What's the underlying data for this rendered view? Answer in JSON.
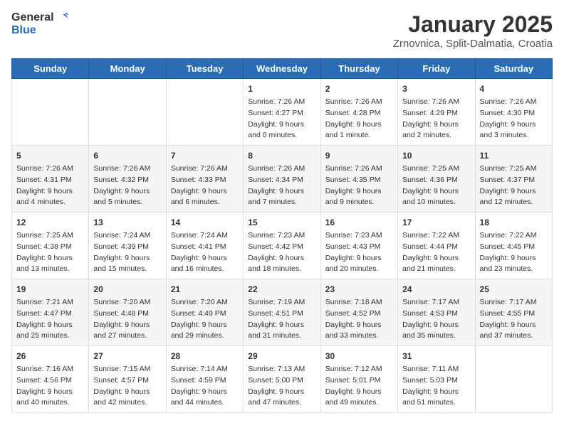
{
  "header": {
    "logo_general": "General",
    "logo_blue": "Blue",
    "title": "January 2025",
    "location": "Zrnovnica, Split-Dalmatia, Croatia"
  },
  "weekdays": [
    "Sunday",
    "Monday",
    "Tuesday",
    "Wednesday",
    "Thursday",
    "Friday",
    "Saturday"
  ],
  "weeks": [
    [
      {
        "day": "",
        "sunrise": "",
        "sunset": "",
        "daylight": "",
        "empty": true
      },
      {
        "day": "",
        "sunrise": "",
        "sunset": "",
        "daylight": "",
        "empty": true
      },
      {
        "day": "",
        "sunrise": "",
        "sunset": "",
        "daylight": "",
        "empty": true
      },
      {
        "day": "1",
        "sunrise": "Sunrise: 7:26 AM",
        "sunset": "Sunset: 4:27 PM",
        "daylight": "Daylight: 9 hours and 0 minutes."
      },
      {
        "day": "2",
        "sunrise": "Sunrise: 7:26 AM",
        "sunset": "Sunset: 4:28 PM",
        "daylight": "Daylight: 9 hours and 1 minute."
      },
      {
        "day": "3",
        "sunrise": "Sunrise: 7:26 AM",
        "sunset": "Sunset: 4:29 PM",
        "daylight": "Daylight: 9 hours and 2 minutes."
      },
      {
        "day": "4",
        "sunrise": "Sunrise: 7:26 AM",
        "sunset": "Sunset: 4:30 PM",
        "daylight": "Daylight: 9 hours and 3 minutes."
      }
    ],
    [
      {
        "day": "5",
        "sunrise": "Sunrise: 7:26 AM",
        "sunset": "Sunset: 4:31 PM",
        "daylight": "Daylight: 9 hours and 4 minutes."
      },
      {
        "day": "6",
        "sunrise": "Sunrise: 7:26 AM",
        "sunset": "Sunset: 4:32 PM",
        "daylight": "Daylight: 9 hours and 5 minutes."
      },
      {
        "day": "7",
        "sunrise": "Sunrise: 7:26 AM",
        "sunset": "Sunset: 4:33 PM",
        "daylight": "Daylight: 9 hours and 6 minutes."
      },
      {
        "day": "8",
        "sunrise": "Sunrise: 7:26 AM",
        "sunset": "Sunset: 4:34 PM",
        "daylight": "Daylight: 9 hours and 7 minutes."
      },
      {
        "day": "9",
        "sunrise": "Sunrise: 7:26 AM",
        "sunset": "Sunset: 4:35 PM",
        "daylight": "Daylight: 9 hours and 9 minutes."
      },
      {
        "day": "10",
        "sunrise": "Sunrise: 7:25 AM",
        "sunset": "Sunset: 4:36 PM",
        "daylight": "Daylight: 9 hours and 10 minutes."
      },
      {
        "day": "11",
        "sunrise": "Sunrise: 7:25 AM",
        "sunset": "Sunset: 4:37 PM",
        "daylight": "Daylight: 9 hours and 12 minutes."
      }
    ],
    [
      {
        "day": "12",
        "sunrise": "Sunrise: 7:25 AM",
        "sunset": "Sunset: 4:38 PM",
        "daylight": "Daylight: 9 hours and 13 minutes."
      },
      {
        "day": "13",
        "sunrise": "Sunrise: 7:24 AM",
        "sunset": "Sunset: 4:39 PM",
        "daylight": "Daylight: 9 hours and 15 minutes."
      },
      {
        "day": "14",
        "sunrise": "Sunrise: 7:24 AM",
        "sunset": "Sunset: 4:41 PM",
        "daylight": "Daylight: 9 hours and 16 minutes."
      },
      {
        "day": "15",
        "sunrise": "Sunrise: 7:23 AM",
        "sunset": "Sunset: 4:42 PM",
        "daylight": "Daylight: 9 hours and 18 minutes."
      },
      {
        "day": "16",
        "sunrise": "Sunrise: 7:23 AM",
        "sunset": "Sunset: 4:43 PM",
        "daylight": "Daylight: 9 hours and 20 minutes."
      },
      {
        "day": "17",
        "sunrise": "Sunrise: 7:22 AM",
        "sunset": "Sunset: 4:44 PM",
        "daylight": "Daylight: 9 hours and 21 minutes."
      },
      {
        "day": "18",
        "sunrise": "Sunrise: 7:22 AM",
        "sunset": "Sunset: 4:45 PM",
        "daylight": "Daylight: 9 hours and 23 minutes."
      }
    ],
    [
      {
        "day": "19",
        "sunrise": "Sunrise: 7:21 AM",
        "sunset": "Sunset: 4:47 PM",
        "daylight": "Daylight: 9 hours and 25 minutes."
      },
      {
        "day": "20",
        "sunrise": "Sunrise: 7:20 AM",
        "sunset": "Sunset: 4:48 PM",
        "daylight": "Daylight: 9 hours and 27 minutes."
      },
      {
        "day": "21",
        "sunrise": "Sunrise: 7:20 AM",
        "sunset": "Sunset: 4:49 PM",
        "daylight": "Daylight: 9 hours and 29 minutes."
      },
      {
        "day": "22",
        "sunrise": "Sunrise: 7:19 AM",
        "sunset": "Sunset: 4:51 PM",
        "daylight": "Daylight: 9 hours and 31 minutes."
      },
      {
        "day": "23",
        "sunrise": "Sunrise: 7:18 AM",
        "sunset": "Sunset: 4:52 PM",
        "daylight": "Daylight: 9 hours and 33 minutes."
      },
      {
        "day": "24",
        "sunrise": "Sunrise: 7:17 AM",
        "sunset": "Sunset: 4:53 PM",
        "daylight": "Daylight: 9 hours and 35 minutes."
      },
      {
        "day": "25",
        "sunrise": "Sunrise: 7:17 AM",
        "sunset": "Sunset: 4:55 PM",
        "daylight": "Daylight: 9 hours and 37 minutes."
      }
    ],
    [
      {
        "day": "26",
        "sunrise": "Sunrise: 7:16 AM",
        "sunset": "Sunset: 4:56 PM",
        "daylight": "Daylight: 9 hours and 40 minutes."
      },
      {
        "day": "27",
        "sunrise": "Sunrise: 7:15 AM",
        "sunset": "Sunset: 4:57 PM",
        "daylight": "Daylight: 9 hours and 42 minutes."
      },
      {
        "day": "28",
        "sunrise": "Sunrise: 7:14 AM",
        "sunset": "Sunset: 4:59 PM",
        "daylight": "Daylight: 9 hours and 44 minutes."
      },
      {
        "day": "29",
        "sunrise": "Sunrise: 7:13 AM",
        "sunset": "Sunset: 5:00 PM",
        "daylight": "Daylight: 9 hours and 47 minutes."
      },
      {
        "day": "30",
        "sunrise": "Sunrise: 7:12 AM",
        "sunset": "Sunset: 5:01 PM",
        "daylight": "Daylight: 9 hours and 49 minutes."
      },
      {
        "day": "31",
        "sunrise": "Sunrise: 7:11 AM",
        "sunset": "Sunset: 5:03 PM",
        "daylight": "Daylight: 9 hours and 51 minutes."
      },
      {
        "day": "",
        "sunrise": "",
        "sunset": "",
        "daylight": "",
        "empty": true
      }
    ]
  ]
}
